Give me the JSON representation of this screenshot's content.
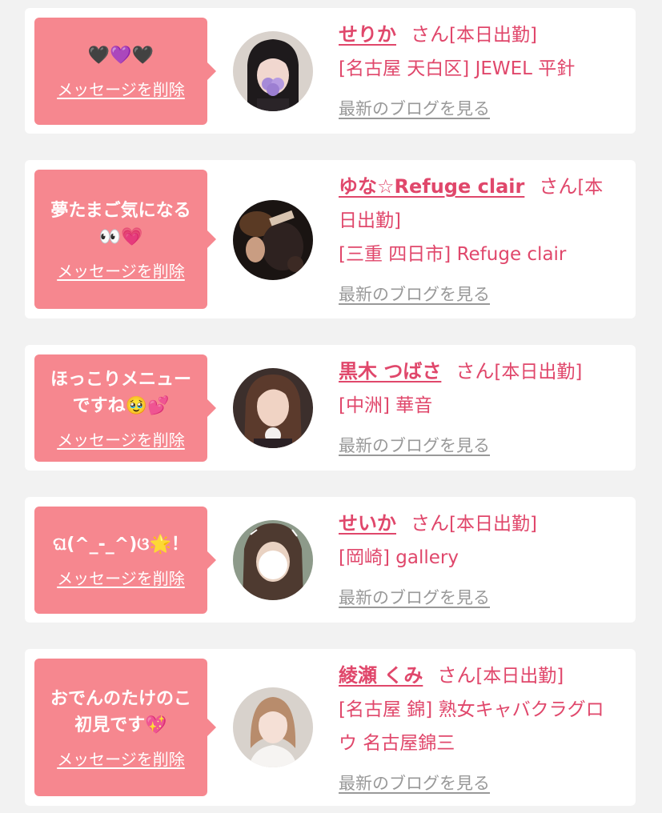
{
  "colors": {
    "background": "#f2f2f2",
    "card": "#ffffff",
    "bubble": "#f6878f",
    "accent": "#e0476b",
    "blog_link": "#999999"
  },
  "delete_label": "メッセージを削除",
  "san_label": "さん",
  "blog_label": "最新のブログを見る",
  "entries": [
    {
      "message": "🖤💜🖤",
      "name": "せりか",
      "status": "[本日出勤]",
      "shop": "[名古屋 天白区] JEWEL 平針",
      "avatar_icon": "girl-with-dark-twin-tails-avatar"
    },
    {
      "message": "夢たまご気になる\n👀💗",
      "name": "ゆな☆Refuge clair",
      "status": "[本日出勤]",
      "shop": "[三重 四日市] Refuge clair",
      "avatar_icon": "dark-photo-avatar"
    },
    {
      "message": "ほっこりメニュー\nですね🥹💕",
      "name": "黒木 つばさ",
      "status": "[本日出勤]",
      "shop": "[中洲] 華音",
      "avatar_icon": "long-hair-woman-avatar"
    },
    {
      "message": "ଘ(^_-_^)ଓ🌟！",
      "name": "せいか",
      "status": "[本日出勤]",
      "shop": "[岡崎] gallery",
      "avatar_icon": "face-blurred-avatar"
    },
    {
      "message": "おでんのたけのこ\n初見です💖",
      "name": "綾瀬 くみ",
      "status": "[本日出勤]",
      "shop": "[名古屋 錦] 熟女キャバクラグロウ 名古屋錦三",
      "avatar_icon": "short-hair-woman-avatar"
    }
  ]
}
